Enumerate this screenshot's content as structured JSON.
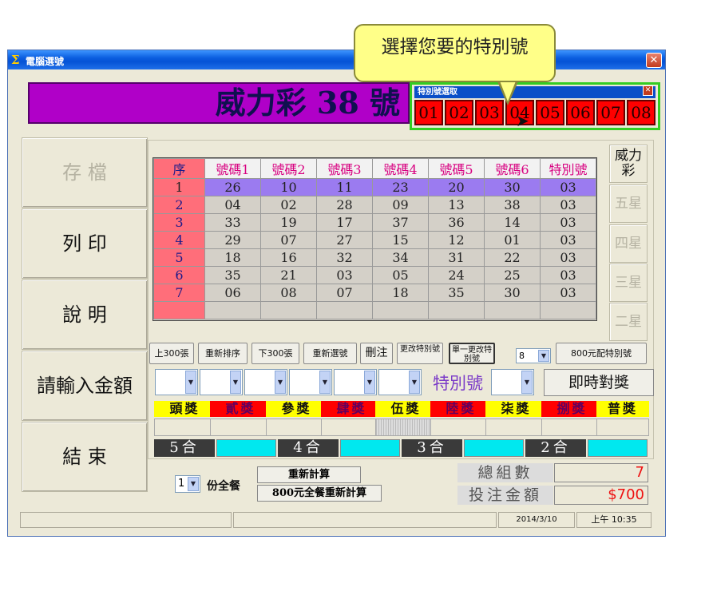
{
  "window": {
    "title": "電腦選號",
    "close_glyph": "✕",
    "icon_glyph": "Σ"
  },
  "callout": {
    "text": "選擇您要的特別號"
  },
  "banner": {
    "text": "威力彩 38 號"
  },
  "special_picker": {
    "title": "特別號選取",
    "close_glyph": "✕",
    "numbers": [
      "01",
      "02",
      "03",
      "04",
      "05",
      "06",
      "07",
      "08"
    ]
  },
  "left_buttons": {
    "save": "存 檔",
    "print": "列 印",
    "help": "說 明",
    "amount": "請輸入金額",
    "exit": "結 束"
  },
  "table": {
    "headers": [
      "序",
      "號碼1",
      "號碼2",
      "號碼3",
      "號碼4",
      "號碼5",
      "號碼6",
      "特別號"
    ],
    "rows": [
      [
        "1",
        "26",
        "10",
        "11",
        "23",
        "20",
        "30",
        "03"
      ],
      [
        "2",
        "04",
        "02",
        "28",
        "09",
        "13",
        "38",
        "03"
      ],
      [
        "3",
        "33",
        "19",
        "17",
        "37",
        "36",
        "14",
        "03"
      ],
      [
        "4",
        "29",
        "07",
        "27",
        "15",
        "12",
        "01",
        "03"
      ],
      [
        "5",
        "18",
        "16",
        "32",
        "34",
        "31",
        "22",
        "03"
      ],
      [
        "6",
        "35",
        "21",
        "03",
        "05",
        "24",
        "25",
        "03"
      ],
      [
        "7",
        "06",
        "08",
        "07",
        "18",
        "35",
        "30",
        "03"
      ],
      [
        "",
        "",
        "",
        "",
        "",
        "",
        "",
        ""
      ]
    ]
  },
  "type_buttons": [
    "威力彩",
    "五星",
    "四星",
    "三星",
    "二星"
  ],
  "toolbar": {
    "prev300": "上300張",
    "resort": "重新排序",
    "next300": "下300張",
    "reselect": "重新選號",
    "delete": "刪注",
    "change_special": "更改特別號",
    "single_change_special": "單一更改特別號",
    "count_value": "8",
    "assign_800": "800元配特別號"
  },
  "selector": {
    "special_label": "特別號",
    "instant_check": "即時對獎"
  },
  "prizes": [
    "頭獎",
    "貳獎",
    "參獎",
    "肆獎",
    "伍獎",
    "陸獎",
    "柒獎",
    "捌獎",
    "普獎"
  ],
  "matches": [
    "5合",
    "4合",
    "3合",
    "2合"
  ],
  "bottom": {
    "portion_value": "1",
    "portion_label": "份全餐",
    "recalc": "重新計算",
    "recalc_800": "800元全餐重新計算",
    "total_groups_label": "總組數",
    "total_groups_value": "7",
    "bet_amount_label": "投注金額",
    "bet_amount_value": "$700"
  },
  "status": {
    "date": "2014/3/10",
    "time": "上午 10:35"
  },
  "colors": {
    "banner_bg": "#b000c8",
    "special_btn": "#ff0000",
    "selected_row": "#9b7bf0",
    "seq_col": "#ff6e7a",
    "match_value": "#00e8ef"
  }
}
